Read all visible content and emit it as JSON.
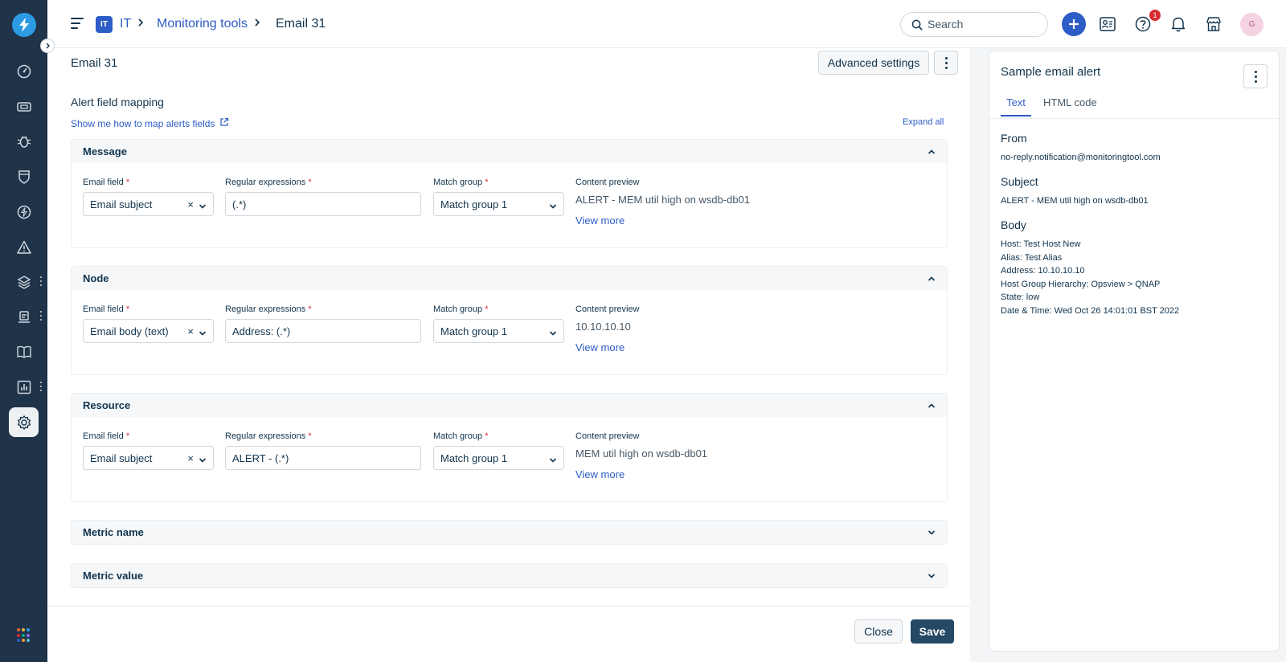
{
  "topbar": {
    "workspace_badge": "IT",
    "breadcrumb": [
      "IT",
      "Monitoring tools",
      "Email 31"
    ],
    "search_placeholder": "Search",
    "help_badge_count": "1",
    "avatar_initial": "G"
  },
  "page": {
    "title": "Email 31",
    "advanced_settings_label": "Advanced settings",
    "section_heading": "Alert field mapping",
    "help_link": "Show me how to map alerts fields",
    "expand_all": "Expand all"
  },
  "columns": {
    "email_field": "Email field",
    "regex": "Regular expressions",
    "match_group": "Match group",
    "content_preview": "Content preview",
    "required_mark": "*",
    "view_more": "View more"
  },
  "mappings": [
    {
      "name": "Message",
      "email_field": "Email subject",
      "regex": "(.*)",
      "match_group": "Match group 1",
      "preview": "ALERT - MEM util high on wsdb-db01"
    },
    {
      "name": "Node",
      "email_field": "Email body (text)",
      "regex": "Address: (.*)",
      "match_group": "Match group 1",
      "preview": "10.10.10.10"
    },
    {
      "name": "Resource",
      "email_field": "Email subject",
      "regex": "ALERT - (.*)",
      "match_group": "Match group 1",
      "preview": "MEM util high on wsdb-db01"
    }
  ],
  "collapsed_sections": [
    "Metric name",
    "Metric value"
  ],
  "footer": {
    "close_label": "Close",
    "save_label": "Save"
  },
  "panel": {
    "title": "Sample email alert",
    "tabs": [
      "Text",
      "HTML code"
    ],
    "active_tab": "Text",
    "from_label": "From",
    "from_value": "no-reply.notification@monitoringtool.com",
    "subject_label": "Subject",
    "subject_value": "ALERT - MEM util high on wsdb-db01",
    "body_label": "Body",
    "body_lines": [
      "Host: Test Host New",
      "Alias: Test Alias",
      "Address: 10.10.10.10",
      "Host Group Hierarchy: Opsview > QNAP",
      "State: low",
      "Date & Time: Wed Oct 26 14:01:01 BST 2022"
    ]
  },
  "colors": {
    "rail": "#1f3349",
    "primary_blue": "#2c5cc5",
    "save_button": "#264966",
    "required": "#d72d30"
  },
  "icons": [
    "bolt-logo-icon",
    "dashboard-icon",
    "ticket-icon",
    "bug-icon",
    "shield-icon",
    "lightning-icon",
    "alert-triangle-icon",
    "layers-icon",
    "devices-icon",
    "book-icon",
    "chart-icon",
    "gear-icon",
    "apps-grid-icon",
    "search-icon",
    "plus-icon",
    "contacts-icon",
    "help-icon",
    "bell-icon",
    "store-icon",
    "external-link-icon",
    "chevron-up-icon",
    "chevron-down-icon"
  ]
}
